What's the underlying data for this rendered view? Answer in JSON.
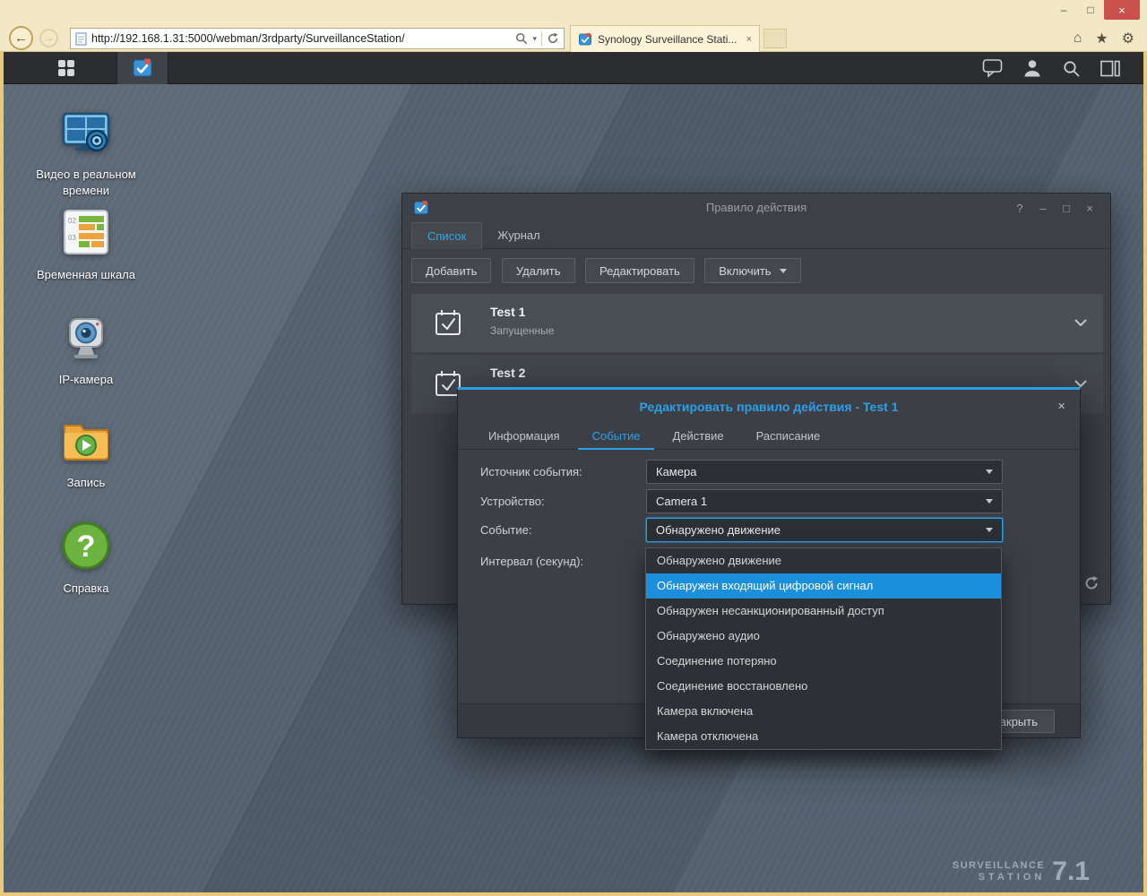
{
  "browser": {
    "window_controls": {
      "minimize": "–",
      "maximize": "□",
      "close": "×"
    },
    "nav": {
      "back_icon": "←",
      "forward_icon": "→"
    },
    "address": {
      "url": "http://192.168.1.31:5000/webman/3rdparty/SurveillanceStation/",
      "search_caret": "▾"
    },
    "tab": {
      "title": "Synology Surveillance Stati...",
      "close_icon": "×"
    },
    "action_icons": {
      "home": "⌂",
      "favorites": "★",
      "tools": "⚙"
    }
  },
  "desktop": {
    "icons": [
      {
        "label": "Видео в реальном времени"
      },
      {
        "label": "Временная шкала"
      },
      {
        "label": "IP-камера"
      },
      {
        "label": "Запись"
      },
      {
        "label": "Справка"
      }
    ],
    "timeline_icon_numbers": [
      "02",
      "03"
    ],
    "help_icon_glyph": "?",
    "watermark": {
      "line1": "SURVEILLANCE",
      "line2": "STATION",
      "version": "7.1"
    }
  },
  "rule_window": {
    "title": "Правило действия",
    "controls": {
      "help": "?",
      "minimize": "–",
      "maximize": "□",
      "close": "×"
    },
    "tabs": [
      {
        "label": "Список"
      },
      {
        "label": "Журнал"
      }
    ],
    "toolbar": {
      "add": "Добавить",
      "remove": "Удалить",
      "edit": "Редактировать",
      "enable": "Включить"
    },
    "rules": [
      {
        "name": "Test 1",
        "status": "Запущенные"
      },
      {
        "name": "Test 2"
      }
    ]
  },
  "dialog": {
    "title": "Редактировать правило действия - Test 1",
    "close_icon": "×",
    "tabs": [
      {
        "label": "Информация"
      },
      {
        "label": "Событие"
      },
      {
        "label": "Действие"
      },
      {
        "label": "Расписание"
      }
    ],
    "form": {
      "source_label": "Источник события:",
      "source_value": "Камера",
      "device_label": "Устройство:",
      "device_value": "Camera 1",
      "event_label": "Событие:",
      "event_value": "Обнаружено движение",
      "interval_label": "Интервал (секунд):"
    },
    "footer": {
      "close": "Закрыть"
    }
  },
  "event_menu": {
    "selected_index": 1,
    "options": [
      {
        "label": "Обнаружено движение"
      },
      {
        "label": "Обнаружен входящий цифровой сигнал"
      },
      {
        "label": "Обнаружен несанкционированный доступ"
      },
      {
        "label": "Обнаружено аудио"
      },
      {
        "label": "Соединение потеряно"
      },
      {
        "label": "Соединение восстановлено"
      },
      {
        "label": "Камера включена"
      },
      {
        "label": "Камера отключена"
      }
    ]
  }
}
